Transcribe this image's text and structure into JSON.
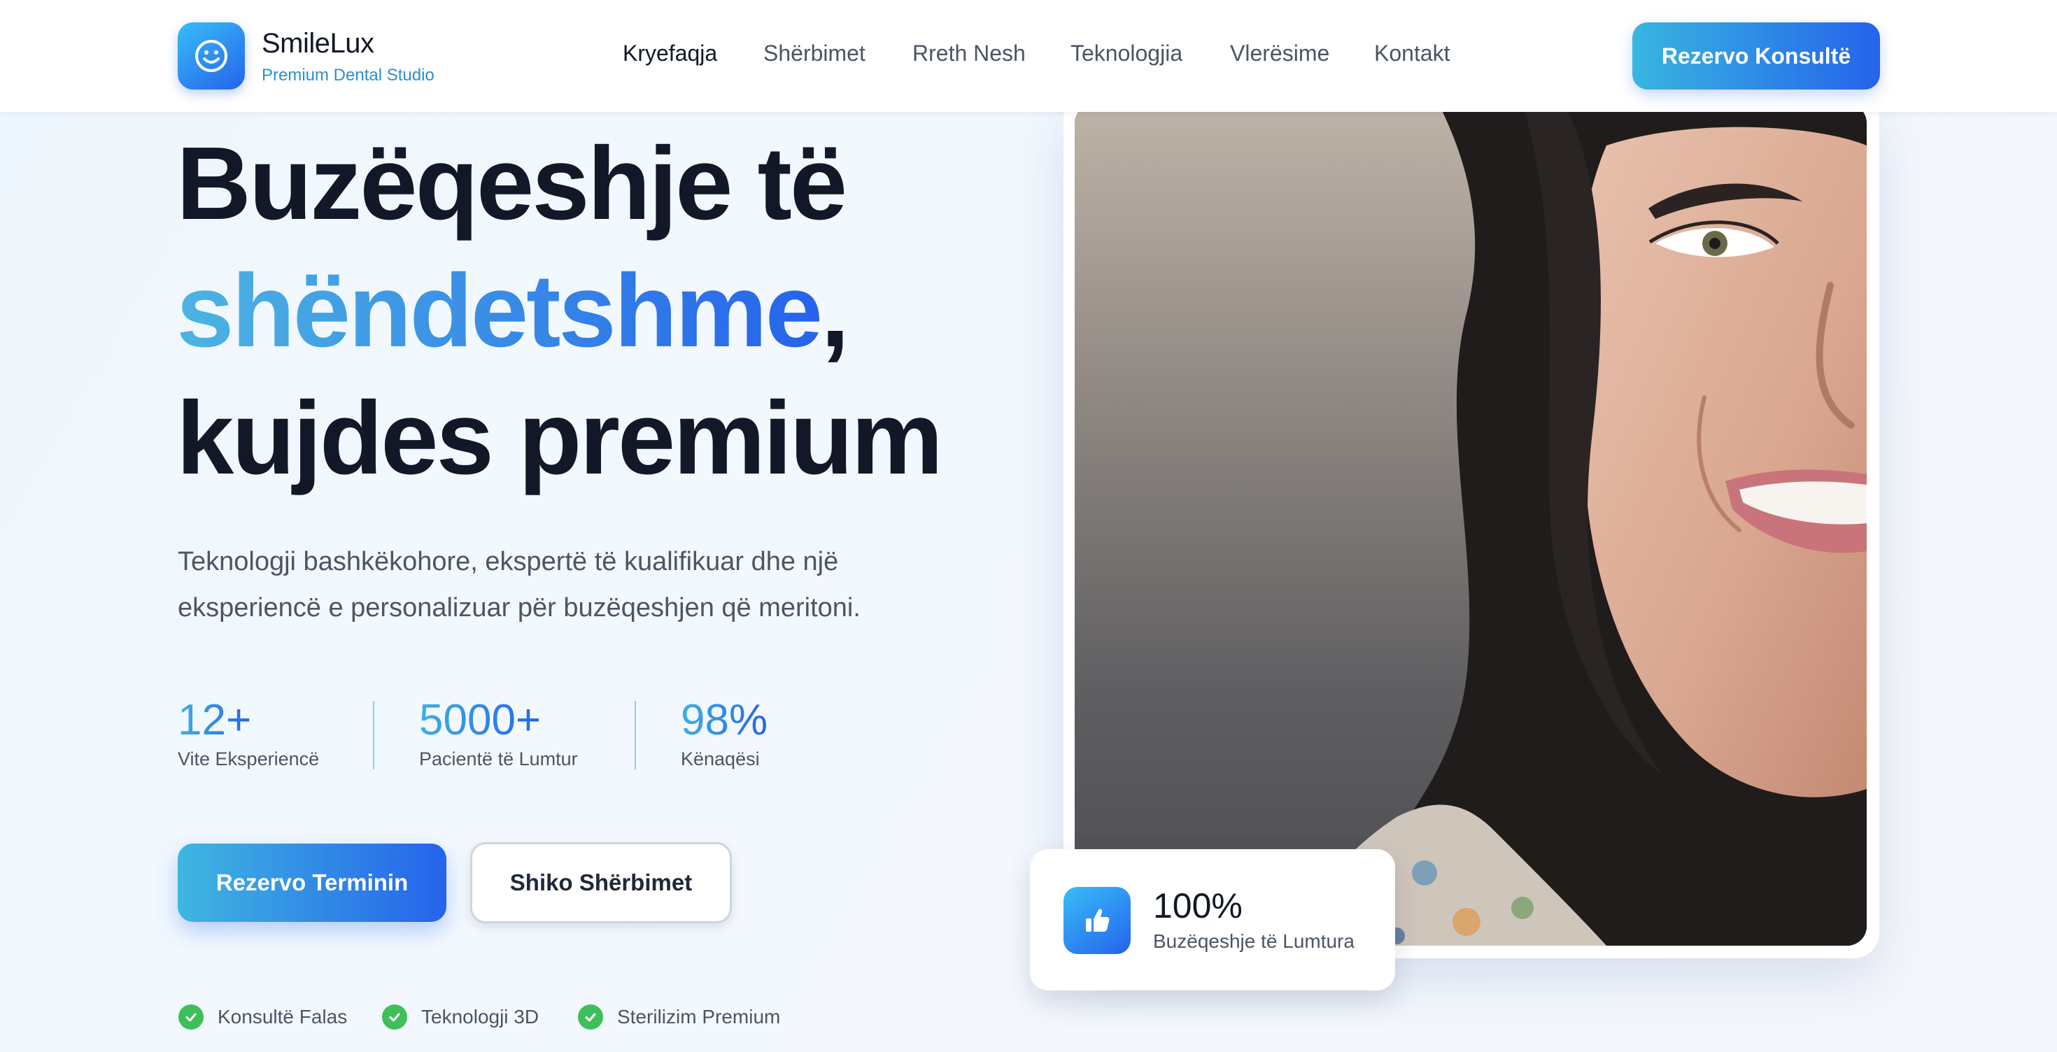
{
  "brand": {
    "name": "SmileLux",
    "tagline": "Premium Dental Studio",
    "logo_icon": "smiley-face-icon"
  },
  "nav": {
    "items": [
      {
        "label": "Kryefaqja",
        "active": true
      },
      {
        "label": "Shërbimet",
        "active": false
      },
      {
        "label": "Rreth Nesh",
        "active": false
      },
      {
        "label": "Teknologjia",
        "active": false
      },
      {
        "label": "Vlerësime",
        "active": false
      },
      {
        "label": "Kontakt",
        "active": false
      }
    ],
    "cta_label": "Rezervo Konsultë"
  },
  "hero": {
    "title_line1": "Buzëqeshje të",
    "title_highlight": "shëndetshme",
    "title_comma": ",",
    "title_line3": "kujdes premium",
    "description": "Teknologji bashkëkohore, ekspertë të kualifikuar dhe një eksperiencë e personalizuar për buzëqeshjen që meritoni.",
    "stats": [
      {
        "value": "12+",
        "label": "Vite Eksperiencë"
      },
      {
        "value": "5000+",
        "label": "Pacientë të Lumtur"
      },
      {
        "value": "98%",
        "label": "Kënaqësi"
      }
    ],
    "primary_button": "Rezervo Terminin",
    "secondary_button": "Shiko Shërbimet",
    "features": [
      {
        "label": "Konsultë Falas",
        "icon": "check-circle-icon"
      },
      {
        "label": "Teknologji 3D",
        "icon": "check-circle-icon"
      },
      {
        "label": "Sterilizim Premium",
        "icon": "check-circle-icon"
      }
    ]
  },
  "badge": {
    "value": "100%",
    "label": "Buzëqeshje të Lumtura",
    "icon": "thumbs-up-icon"
  },
  "colors": {
    "accent_start": "#38b6e0",
    "accent_end": "#2563eb",
    "check_green": "#3fbf5a",
    "text_dark": "#111827",
    "text_muted": "#4b5563"
  }
}
